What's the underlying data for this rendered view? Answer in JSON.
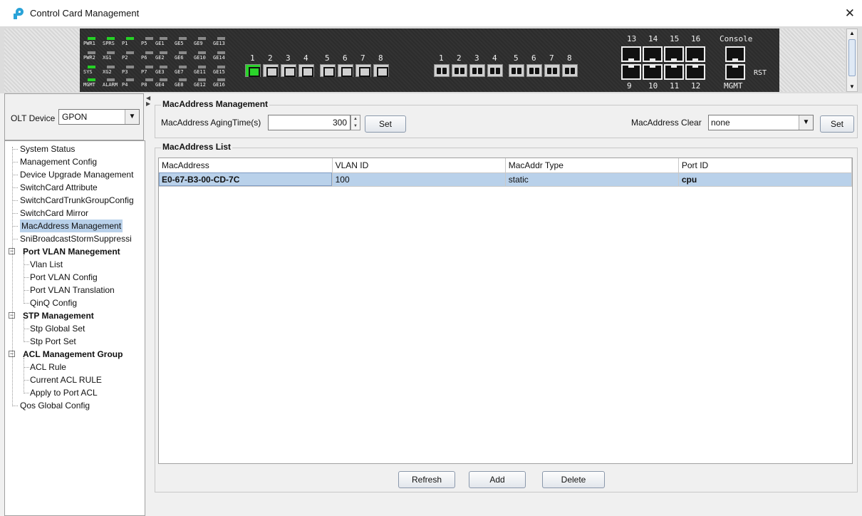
{
  "window": {
    "title": "Control Card Management",
    "close_glyph": "✕",
    "app_icon": "app-logo-icon"
  },
  "device_panel": {
    "leds": [
      {
        "label": "PWR1",
        "on": true
      },
      {
        "label": "SPRS",
        "on": true
      },
      {
        "label": "P1",
        "on": true
      },
      {
        "label": "P5",
        "on": false
      },
      {
        "label": "GE1",
        "on": false
      },
      {
        "label": "GE5",
        "on": false
      },
      {
        "label": "GE9",
        "on": false
      },
      {
        "label": "GE13",
        "on": false
      },
      {
        "label": "PWR2",
        "on": false
      },
      {
        "label": "XG1",
        "on": false
      },
      {
        "label": "P2",
        "on": false
      },
      {
        "label": "P6",
        "on": false
      },
      {
        "label": "GE2",
        "on": false
      },
      {
        "label": "GE6",
        "on": false
      },
      {
        "label": "GE10",
        "on": false
      },
      {
        "label": "GE14",
        "on": false
      },
      {
        "label": "SYS",
        "on": true
      },
      {
        "label": "XG2",
        "on": false
      },
      {
        "label": "P3",
        "on": false
      },
      {
        "label": "P7",
        "on": false
      },
      {
        "label": "GE3",
        "on": false
      },
      {
        "label": "GE7",
        "on": false
      },
      {
        "label": "GE11",
        "on": false
      },
      {
        "label": "GE15",
        "on": false
      },
      {
        "label": "MGMT",
        "on": true
      },
      {
        "label": "ALARM",
        "on": false
      },
      {
        "label": "P4",
        "on": false
      },
      {
        "label": "P8",
        "on": false
      },
      {
        "label": "GE4",
        "on": false
      },
      {
        "label": "GE8",
        "on": false
      },
      {
        "label": "GE12",
        "on": false
      },
      {
        "label": "GE16",
        "on": false
      }
    ],
    "sfp_ports": [
      {
        "num": "1",
        "active": true
      },
      {
        "num": "2",
        "active": false
      },
      {
        "num": "3",
        "active": false
      },
      {
        "num": "4",
        "active": false
      },
      {
        "num": "5",
        "active": false
      },
      {
        "num": "6",
        "active": false
      },
      {
        "num": "7",
        "active": false
      },
      {
        "num": "8",
        "active": false
      }
    ],
    "pon_ports": [
      "1",
      "2",
      "3",
      "4",
      "5",
      "6",
      "7",
      "8"
    ],
    "rj_top_labels": [
      "13",
      "14",
      "15",
      "16"
    ],
    "rj_bottom_labels": [
      "9",
      "10",
      "11",
      "12"
    ],
    "console_label": "Console",
    "mgmt_label": "MGMT",
    "rst_label": "RST"
  },
  "olt": {
    "label": "OLT Device",
    "value": "GPON"
  },
  "tree": {
    "items": [
      {
        "label": "System Status",
        "level": 0,
        "group": false,
        "selected": false
      },
      {
        "label": "Management Config",
        "level": 0,
        "group": false,
        "selected": false
      },
      {
        "label": "Device Upgrade Management",
        "level": 0,
        "group": false,
        "selected": false
      },
      {
        "label": "SwitchCard Attribute",
        "level": 0,
        "group": false,
        "selected": false
      },
      {
        "label": "SwitchCardTrunkGroupConfig",
        "level": 0,
        "group": false,
        "selected": false
      },
      {
        "label": "SwitchCard Mirror",
        "level": 0,
        "group": false,
        "selected": false
      },
      {
        "label": "MacAddress Management",
        "level": 0,
        "group": false,
        "selected": true
      },
      {
        "label": "SniBroadcastStormSuppressi",
        "level": 0,
        "group": false,
        "selected": false
      },
      {
        "label": "Port VLAN Manegement",
        "level": 0,
        "group": true,
        "selected": false
      },
      {
        "label": "Vlan List",
        "level": 1,
        "group": false,
        "selected": false
      },
      {
        "label": "Port VLAN Config",
        "level": 1,
        "group": false,
        "selected": false
      },
      {
        "label": "Port VLAN Translation",
        "level": 1,
        "group": false,
        "selected": false
      },
      {
        "label": "QinQ Config",
        "level": 1,
        "group": false,
        "selected": false
      },
      {
        "label": "STP Management",
        "level": 0,
        "group": true,
        "selected": false
      },
      {
        "label": "Stp Global Set",
        "level": 1,
        "group": false,
        "selected": false
      },
      {
        "label": "Stp Port Set",
        "level": 1,
        "group": false,
        "selected": false
      },
      {
        "label": "ACL Management Group",
        "level": 0,
        "group": true,
        "selected": false
      },
      {
        "label": "ACL Rule",
        "level": 1,
        "group": false,
        "selected": false
      },
      {
        "label": "Current ACL RULE",
        "level": 1,
        "group": false,
        "selected": false
      },
      {
        "label": "Apply to Port ACL",
        "level": 1,
        "group": false,
        "selected": false
      },
      {
        "label": "Qos Global Config",
        "level": 0,
        "group": false,
        "selected": false
      }
    ],
    "toggle_glyph": "−"
  },
  "mac_mgmt": {
    "title": "MacAddress Management",
    "aging_label": "MacAddress AgingTime(s)",
    "aging_value": "300",
    "set_label": "Set",
    "clear_label": "MacAddress Clear",
    "clear_value": "none",
    "clear_set_label": "Set"
  },
  "mac_list": {
    "title": "MacAddress List",
    "columns": [
      "MacAddress",
      "VLAN ID",
      "MacAddr Type",
      "Port ID"
    ],
    "rows": [
      {
        "mac": "E0-67-B3-00-CD-7C",
        "vlan": "100",
        "type": "static",
        "port": "cpu",
        "selected": true
      }
    ]
  },
  "actions": {
    "refresh": "Refresh",
    "add": "Add",
    "delete": "Delete"
  },
  "colors": {
    "accent_selection": "#b9d1ea",
    "led_on": "#25d125",
    "app_icon": "#2aa3d8"
  }
}
